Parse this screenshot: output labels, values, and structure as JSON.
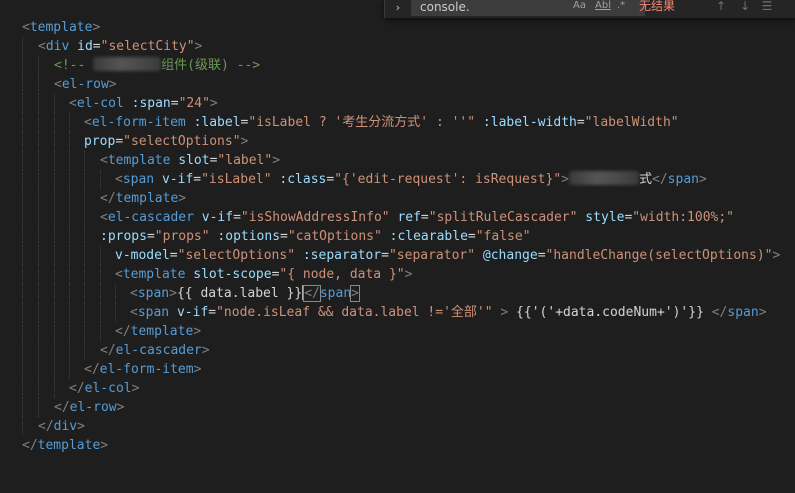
{
  "find_widget": {
    "query": "console.",
    "match_case_label": "Aa",
    "whole_word_label": "Abl",
    "regex_label": ".*",
    "status": "无结果"
  },
  "code": {
    "l1_tag": "template",
    "l2_tag": "div",
    "l2_attr": "id",
    "l2_val": "\"selectCity\"",
    "l3_open": "<!-- ",
    "l3_text": "组件(级联) -->",
    "l4_tag": "el-row",
    "l5_tag": "el-col",
    "l5_attr": ":span",
    "l5_val": "\"24\"",
    "l6_tag": "el-form-item",
    "l6_attr1": ":label",
    "l6_v1": "\"isLabel ? '考生分流方式' : ''\"",
    "l6_attr2": ":label-width",
    "l6_v2": "\"labelWidth\"",
    "l7_attr": "prop",
    "l7_val": "\"selectOptions\"",
    "l8_tag": "template",
    "l8_attr": "slot",
    "l8_val": "\"label\"",
    "l9_tag": "span",
    "l9_attr1": "v-if",
    "l9_v1": "\"isLabel\"",
    "l9_attr2": ":class",
    "l9_v2": "\"{'edit-request': isRequest}\"",
    "l9_text": "式",
    "l9_close": "span",
    "l10_tag": "template",
    "l11_tag": "el-cascader",
    "l11_attr1": "v-if",
    "l11_v1": "\"isShowAddressInfo\"",
    "l11_attr2": "ref",
    "l11_v2": "\"splitRuleCascader\"",
    "l11_attr3": "style",
    "l11_v3": "\"width:100%;\"",
    "l12_attr1": ":props",
    "l12_v1": "\"props\"",
    "l12_attr2": ":options",
    "l12_v2": "\"catOptions\"",
    "l12_attr3": ":clearable",
    "l12_v3": "\"false\"",
    "l13_attr1": "v-model",
    "l13_v1": "\"selectOptions\"",
    "l13_attr2": ":separator",
    "l13_v2": "\"separator\"",
    "l13_attr3": "@change",
    "l13_v3": "\"handleChange(selectOptions)\"",
    "l14_tag": "template",
    "l14_attr": "slot-scope",
    "l14_val": "\"{ node, data }\"",
    "l15_tag": "span",
    "l15_text": "{{ data.label }}",
    "l15_close": "span",
    "l16_tag": "span",
    "l16_attr": "v-if",
    "l16_val": "\"node.isLeaf && data.label !='全部'\"",
    "l16_text": " {{'('+data.codeNum+')'}} ",
    "l16_close": "span",
    "l17_tag": "template",
    "l18_tag": "el-cascader",
    "l19_tag": "el-form-item",
    "l20_tag": "el-col",
    "l21_tag": "el-row",
    "l22_tag": "div",
    "l23_tag": "template"
  }
}
